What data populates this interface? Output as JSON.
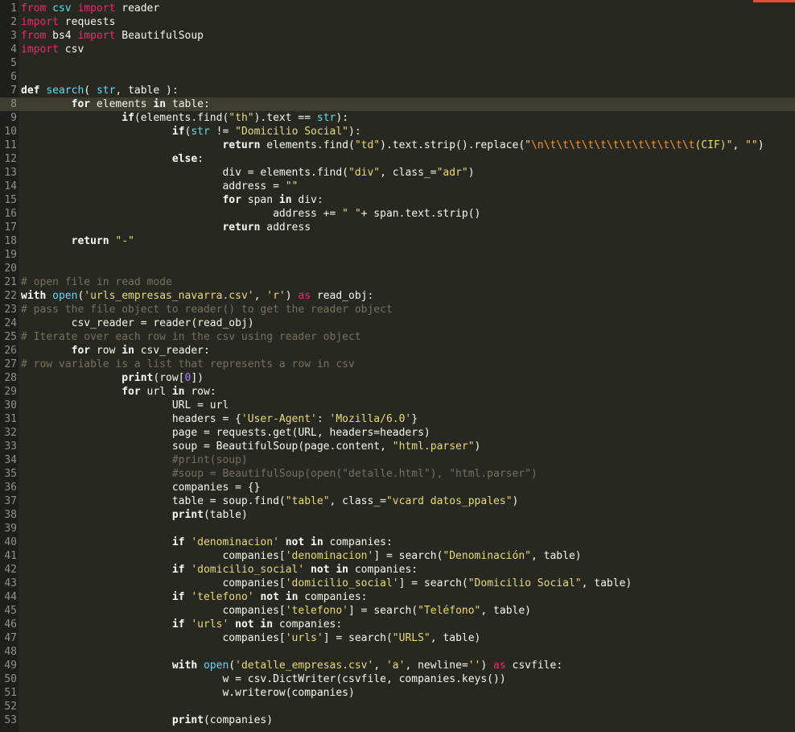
{
  "editor": {
    "current_line": 8,
    "accent_color": "#e2532b",
    "lines": [
      {
        "n": "1",
        "tokens": [
          [
            "kw",
            "from"
          ],
          [
            "t",
            " "
          ],
          [
            "mod",
            "csv"
          ],
          [
            "t",
            " "
          ],
          [
            "kw",
            "import"
          ],
          [
            "t",
            " reader"
          ]
        ]
      },
      {
        "n": "2",
        "tokens": [
          [
            "kw",
            "import"
          ],
          [
            "t",
            " requests"
          ]
        ]
      },
      {
        "n": "3",
        "tokens": [
          [
            "kw",
            "from"
          ],
          [
            "t",
            " bs4 "
          ],
          [
            "kw",
            "import"
          ],
          [
            "t",
            " BeautifulSoup"
          ]
        ]
      },
      {
        "n": "4",
        "tokens": [
          [
            "kw",
            "import"
          ],
          [
            "t",
            " csv"
          ]
        ]
      },
      {
        "n": "5",
        "tokens": []
      },
      {
        "n": "6",
        "tokens": []
      },
      {
        "n": "7",
        "tokens": [
          [
            "kwb",
            "def"
          ],
          [
            "t",
            " "
          ],
          [
            "fn",
            "search"
          ],
          [
            "t",
            "( "
          ],
          [
            "bi",
            "str"
          ],
          [
            "t",
            ", table ):"
          ]
        ]
      },
      {
        "n": "8",
        "tokens": [
          [
            "t",
            "        "
          ],
          [
            "kwb",
            "for"
          ],
          [
            "t",
            " elements "
          ],
          [
            "kwb",
            "in"
          ],
          [
            "t",
            " table:"
          ]
        ]
      },
      {
        "n": "9",
        "tokens": [
          [
            "t",
            "                "
          ],
          [
            "kwb",
            "if"
          ],
          [
            "t",
            "(elements.find("
          ],
          [
            "st",
            "\"th\""
          ],
          [
            "t",
            ").text == "
          ],
          [
            "bi",
            "str"
          ],
          [
            "t",
            "):"
          ]
        ]
      },
      {
        "n": "10",
        "tokens": [
          [
            "t",
            "                        "
          ],
          [
            "kwb",
            "if"
          ],
          [
            "t",
            "("
          ],
          [
            "bi",
            "str"
          ],
          [
            "t",
            " != "
          ],
          [
            "st",
            "\"Domicilio Social\""
          ],
          [
            "t",
            "):"
          ]
        ]
      },
      {
        "n": "11",
        "tokens": [
          [
            "t",
            "                                "
          ],
          [
            "kwb",
            "return"
          ],
          [
            "t",
            " elements.find("
          ],
          [
            "st",
            "\"td\""
          ],
          [
            "t",
            ").text.strip().replace("
          ],
          [
            "st",
            "\""
          ],
          [
            "esc",
            "\\n\\t\\t\\t\\t\\t\\t\\t\\t\\t\\t\\t\\t"
          ],
          [
            "st",
            "(CIF)\""
          ],
          [
            "t",
            ", "
          ],
          [
            "st",
            "\"\""
          ],
          [
            "t",
            ")"
          ]
        ]
      },
      {
        "n": "12",
        "tokens": [
          [
            "t",
            "                        "
          ],
          [
            "kwb",
            "else"
          ],
          [
            "t",
            ":"
          ]
        ]
      },
      {
        "n": "13",
        "tokens": [
          [
            "t",
            "                                div = elements.find("
          ],
          [
            "st",
            "\"div\""
          ],
          [
            "t",
            ", class_="
          ],
          [
            "st",
            "\"adr\""
          ],
          [
            "t",
            ")"
          ]
        ]
      },
      {
        "n": "14",
        "tokens": [
          [
            "t",
            "                                address = "
          ],
          [
            "st",
            "\"\""
          ]
        ]
      },
      {
        "n": "15",
        "tokens": [
          [
            "t",
            "                                "
          ],
          [
            "kwb",
            "for"
          ],
          [
            "t",
            " span "
          ],
          [
            "kwb",
            "in"
          ],
          [
            "t",
            " div:"
          ]
        ]
      },
      {
        "n": "16",
        "tokens": [
          [
            "t",
            "                                        address += "
          ],
          [
            "st",
            "\" \""
          ],
          [
            "t",
            "+ span.text.strip()"
          ]
        ]
      },
      {
        "n": "17",
        "tokens": [
          [
            "t",
            "                                "
          ],
          [
            "kwb",
            "return"
          ],
          [
            "t",
            " address"
          ]
        ]
      },
      {
        "n": "18",
        "tokens": [
          [
            "t",
            "        "
          ],
          [
            "kwb",
            "return"
          ],
          [
            "t",
            " "
          ],
          [
            "st",
            "\"-\""
          ]
        ]
      },
      {
        "n": "19",
        "tokens": []
      },
      {
        "n": "20",
        "tokens": []
      },
      {
        "n": "21",
        "tokens": [
          [
            "cm",
            "# open file in read mode"
          ]
        ]
      },
      {
        "n": "22",
        "tokens": [
          [
            "kwb",
            "with"
          ],
          [
            "t",
            " "
          ],
          [
            "bi",
            "open"
          ],
          [
            "t",
            "("
          ],
          [
            "st",
            "'urls_empresas_navarra.csv'"
          ],
          [
            "t",
            ", "
          ],
          [
            "st",
            "'r'"
          ],
          [
            "t",
            ") "
          ],
          [
            "kw",
            "as"
          ],
          [
            "t",
            " read_obj:"
          ]
        ]
      },
      {
        "n": "23",
        "tokens": [
          [
            "cm",
            "# pass the file object to reader() to get the reader object"
          ]
        ]
      },
      {
        "n": "24",
        "tokens": [
          [
            "t",
            "        csv_reader = reader(read_obj)"
          ]
        ]
      },
      {
        "n": "25",
        "tokens": [
          [
            "cm",
            "# Iterate over each row in the csv using reader object"
          ]
        ]
      },
      {
        "n": "26",
        "tokens": [
          [
            "t",
            "        "
          ],
          [
            "kwb",
            "for"
          ],
          [
            "t",
            " row "
          ],
          [
            "kwb",
            "in"
          ],
          [
            "t",
            " csv_reader:"
          ]
        ]
      },
      {
        "n": "27",
        "tokens": [
          [
            "cm",
            "# row variable is a list that represents a row in csv"
          ]
        ]
      },
      {
        "n": "28",
        "tokens": [
          [
            "t",
            "                "
          ],
          [
            "kwb",
            "print"
          ],
          [
            "t",
            "(row["
          ],
          [
            "nm",
            "0"
          ],
          [
            "t",
            "])"
          ]
        ]
      },
      {
        "n": "29",
        "tokens": [
          [
            "t",
            "                "
          ],
          [
            "kwb",
            "for"
          ],
          [
            "t",
            " url "
          ],
          [
            "kwb",
            "in"
          ],
          [
            "t",
            " row:"
          ]
        ]
      },
      {
        "n": "30",
        "tokens": [
          [
            "t",
            "                        URL = url"
          ]
        ]
      },
      {
        "n": "31",
        "tokens": [
          [
            "t",
            "                        headers = {"
          ],
          [
            "st",
            "'User-Agent'"
          ],
          [
            "t",
            ": "
          ],
          [
            "st",
            "'Mozilla/6.0'"
          ],
          [
            "t",
            "}"
          ]
        ]
      },
      {
        "n": "32",
        "tokens": [
          [
            "t",
            "                        page = requests.get(URL, headers=headers)"
          ]
        ]
      },
      {
        "n": "33",
        "tokens": [
          [
            "t",
            "                        soup = BeautifulSoup(page.content, "
          ],
          [
            "st",
            "\"html.parser\""
          ],
          [
            "t",
            ")"
          ]
        ]
      },
      {
        "n": "34",
        "tokens": [
          [
            "t",
            "                        "
          ],
          [
            "cm",
            "#print(soup)"
          ]
        ]
      },
      {
        "n": "35",
        "tokens": [
          [
            "t",
            "                        "
          ],
          [
            "cm",
            "#soup = BeautifulSoup(open(\"detalle.html\"), \"html.parser\")"
          ]
        ]
      },
      {
        "n": "36",
        "tokens": [
          [
            "t",
            "                        companies = {}"
          ]
        ]
      },
      {
        "n": "37",
        "tokens": [
          [
            "t",
            "                        table = soup.find("
          ],
          [
            "st",
            "\"table\""
          ],
          [
            "t",
            ", class_="
          ],
          [
            "st",
            "\"vcard datos_ppales\""
          ],
          [
            "t",
            ")"
          ]
        ]
      },
      {
        "n": "38",
        "tokens": [
          [
            "t",
            "                        "
          ],
          [
            "kwb",
            "print"
          ],
          [
            "t",
            "(table)"
          ]
        ]
      },
      {
        "n": "39",
        "tokens": []
      },
      {
        "n": "40",
        "tokens": [
          [
            "t",
            "                        "
          ],
          [
            "kwb",
            "if"
          ],
          [
            "t",
            " "
          ],
          [
            "st",
            "'denominacion'"
          ],
          [
            "t",
            " "
          ],
          [
            "kwb",
            "not in"
          ],
          [
            "t",
            " companies:"
          ]
        ]
      },
      {
        "n": "41",
        "tokens": [
          [
            "t",
            "                                companies["
          ],
          [
            "st",
            "'denominacion'"
          ],
          [
            "t",
            "] = search("
          ],
          [
            "st",
            "\"Denominación\""
          ],
          [
            "t",
            ", table)"
          ]
        ]
      },
      {
        "n": "42",
        "tokens": [
          [
            "t",
            "                        "
          ],
          [
            "kwb",
            "if"
          ],
          [
            "t",
            " "
          ],
          [
            "st",
            "'domicilio_social'"
          ],
          [
            "t",
            " "
          ],
          [
            "kwb",
            "not in"
          ],
          [
            "t",
            " companies:"
          ]
        ]
      },
      {
        "n": "43",
        "tokens": [
          [
            "t",
            "                                companies["
          ],
          [
            "st",
            "'domicilio_social'"
          ],
          [
            "t",
            "] = search("
          ],
          [
            "st",
            "\"Domicilio Social\""
          ],
          [
            "t",
            ", table)"
          ]
        ]
      },
      {
        "n": "44",
        "tokens": [
          [
            "t",
            "                        "
          ],
          [
            "kwb",
            "if"
          ],
          [
            "t",
            " "
          ],
          [
            "st",
            "'telefono'"
          ],
          [
            "t",
            " "
          ],
          [
            "kwb",
            "not in"
          ],
          [
            "t",
            " companies:"
          ]
        ]
      },
      {
        "n": "45",
        "tokens": [
          [
            "t",
            "                                companies["
          ],
          [
            "st",
            "'telefono'"
          ],
          [
            "t",
            "] = search("
          ],
          [
            "st",
            "\"Teléfono\""
          ],
          [
            "t",
            ", table)"
          ]
        ]
      },
      {
        "n": "46",
        "tokens": [
          [
            "t",
            "                        "
          ],
          [
            "kwb",
            "if"
          ],
          [
            "t",
            " "
          ],
          [
            "st",
            "'urls'"
          ],
          [
            "t",
            " "
          ],
          [
            "kwb",
            "not in"
          ],
          [
            "t",
            " companies:"
          ]
        ]
      },
      {
        "n": "47",
        "tokens": [
          [
            "t",
            "                                companies["
          ],
          [
            "st",
            "'urls'"
          ],
          [
            "t",
            "] = search("
          ],
          [
            "st",
            "\"URLS\""
          ],
          [
            "t",
            ", table)"
          ]
        ]
      },
      {
        "n": "48",
        "tokens": []
      },
      {
        "n": "49",
        "tokens": [
          [
            "t",
            "                        "
          ],
          [
            "kwb",
            "with"
          ],
          [
            "t",
            " "
          ],
          [
            "bi",
            "open"
          ],
          [
            "t",
            "("
          ],
          [
            "st",
            "'detalle_empresas.csv'"
          ],
          [
            "t",
            ", "
          ],
          [
            "st",
            "'a'"
          ],
          [
            "t",
            ", newline="
          ],
          [
            "st",
            "''"
          ],
          [
            "t",
            ") "
          ],
          [
            "kw",
            "as"
          ],
          [
            "t",
            " csvfile:"
          ]
        ]
      },
      {
        "n": "50",
        "tokens": [
          [
            "t",
            "                                w = csv.DictWriter(csvfile, companies.keys())"
          ]
        ]
      },
      {
        "n": "51",
        "tokens": [
          [
            "t",
            "                                w.writerow(companies)"
          ]
        ]
      },
      {
        "n": "52",
        "tokens": []
      },
      {
        "n": "53",
        "tokens": [
          [
            "t",
            "                        "
          ],
          [
            "kwb",
            "print"
          ],
          [
            "t",
            "(companies)"
          ]
        ]
      }
    ]
  }
}
